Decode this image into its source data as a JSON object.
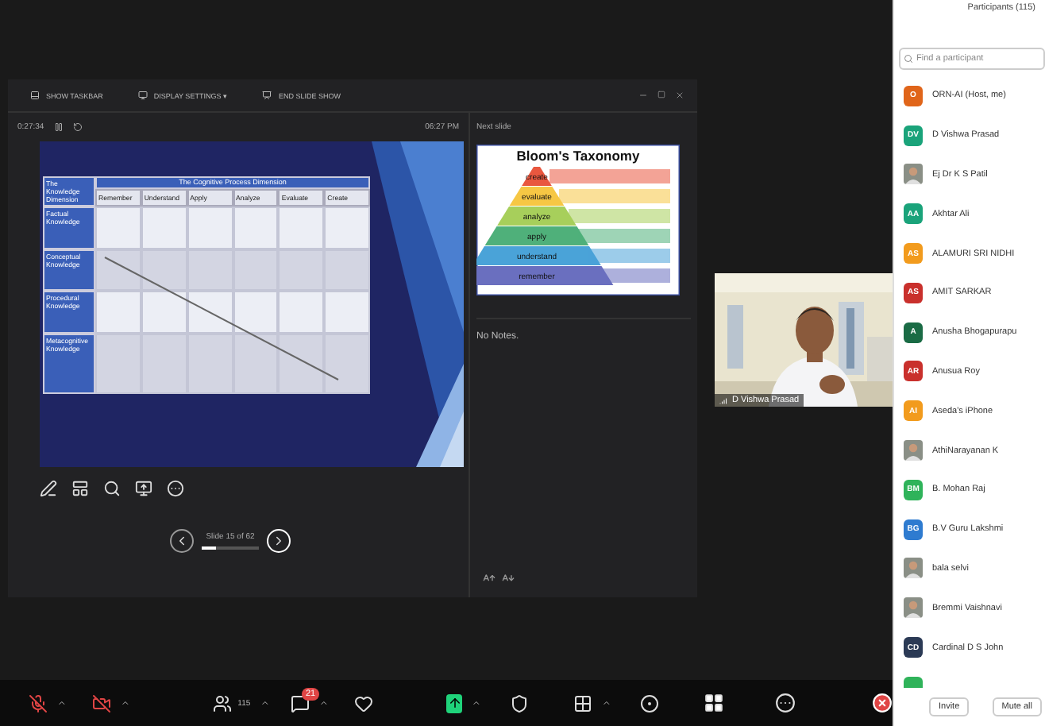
{
  "presenter": {
    "toolbar": [
      {
        "kind": "taskbar",
        "label": "SHOW TASKBAR"
      },
      {
        "kind": "display",
        "label": "DISPLAY SETTINGS ▾"
      },
      {
        "kind": "end",
        "label": "END SLIDE SHOW"
      }
    ],
    "timer": "0:27:34",
    "clock": "06:27 PM",
    "next_label": "Next slide",
    "notes": "No Notes.",
    "slide": {
      "corner": "The Knowledge Dimension",
      "title": "The Cognitive Process Dimension",
      "columns": [
        "Remember",
        "Understand",
        "Apply",
        "Analyze",
        "Evaluate",
        "Create"
      ],
      "rows": [
        "Factual Knowledge",
        "Conceptual Knowledge",
        "Procedural Knowledge",
        "Metacognitive Knowledge"
      ]
    },
    "next_slide": {
      "title": "Bloom's Taxonomy",
      "levels": [
        {
          "label": "create",
          "color": "#e9573f"
        },
        {
          "label": "evaluate",
          "color": "#f6c744"
        },
        {
          "label": "analyze",
          "color": "#a7cf5b"
        },
        {
          "label": "apply",
          "color": "#4fb07a"
        },
        {
          "label": "understand",
          "color": "#4aa3d8"
        },
        {
          "label": "remember",
          "color": "#6a6fbf"
        }
      ]
    },
    "navigation": {
      "label": "Slide 15 of 62",
      "level": 0.24
    }
  },
  "video": {
    "name": "D Vishwa Prasad"
  },
  "meeting_toolbar": {
    "audio_muted": true,
    "video_off": true,
    "participants_count": "115",
    "chat_badge": "21"
  },
  "participants": {
    "title": "Participants (115)",
    "search": {
      "placeholder": "Find a participant"
    },
    "items": [
      {
        "kind": "initials",
        "name": "ORN-AI (Host, me)",
        "initials": "O",
        "color": "#e0651a"
      },
      {
        "kind": "initials",
        "name": "D Vishwa Prasad",
        "initials": "DV",
        "color": "#1aa37a"
      },
      {
        "name": "Ej Dr K S Patil"
      },
      {
        "kind": "initials",
        "name": "Akhtar Ali",
        "initials": "AA",
        "color": "#1aa37a"
      },
      {
        "kind": "initials",
        "name": "ALAMURI SRI NIDHI",
        "initials": "AS",
        "color": "#f29b1d"
      },
      {
        "kind": "initials",
        "name": "AMIT SARKAR",
        "initials": "AS",
        "color": "#c9302c"
      },
      {
        "kind": "initials",
        "name": "Anusha Bhogapurapu",
        "initials": "A",
        "color": "#1a6b45"
      },
      {
        "kind": "initials",
        "name": "Anusua Roy",
        "initials": "AR",
        "color": "#c9302c"
      },
      {
        "kind": "initials",
        "name": "Aseda's iPhone",
        "initials": "AI",
        "color": "#f29b1d"
      },
      {
        "name": "AthiNarayanan K"
      },
      {
        "kind": "initials",
        "name": "B. Mohan Raj",
        "initials": "BM",
        "color": "#2fb35a"
      },
      {
        "kind": "initials",
        "name": "B.V Guru Lakshmi",
        "initials": "BG",
        "color": "#2e7bd0"
      },
      {
        "name": "bala selvi"
      },
      {
        "name": "Bremmi Vaishnavi"
      },
      {
        "kind": "initials",
        "name": "Cardinal D S John",
        "initials": "CD",
        "color": "#2b3a55"
      },
      {
        "kind": "initials",
        "color": "#2fb35a"
      }
    ],
    "buttons": [
      "Invite",
      "Mute all"
    ]
  }
}
